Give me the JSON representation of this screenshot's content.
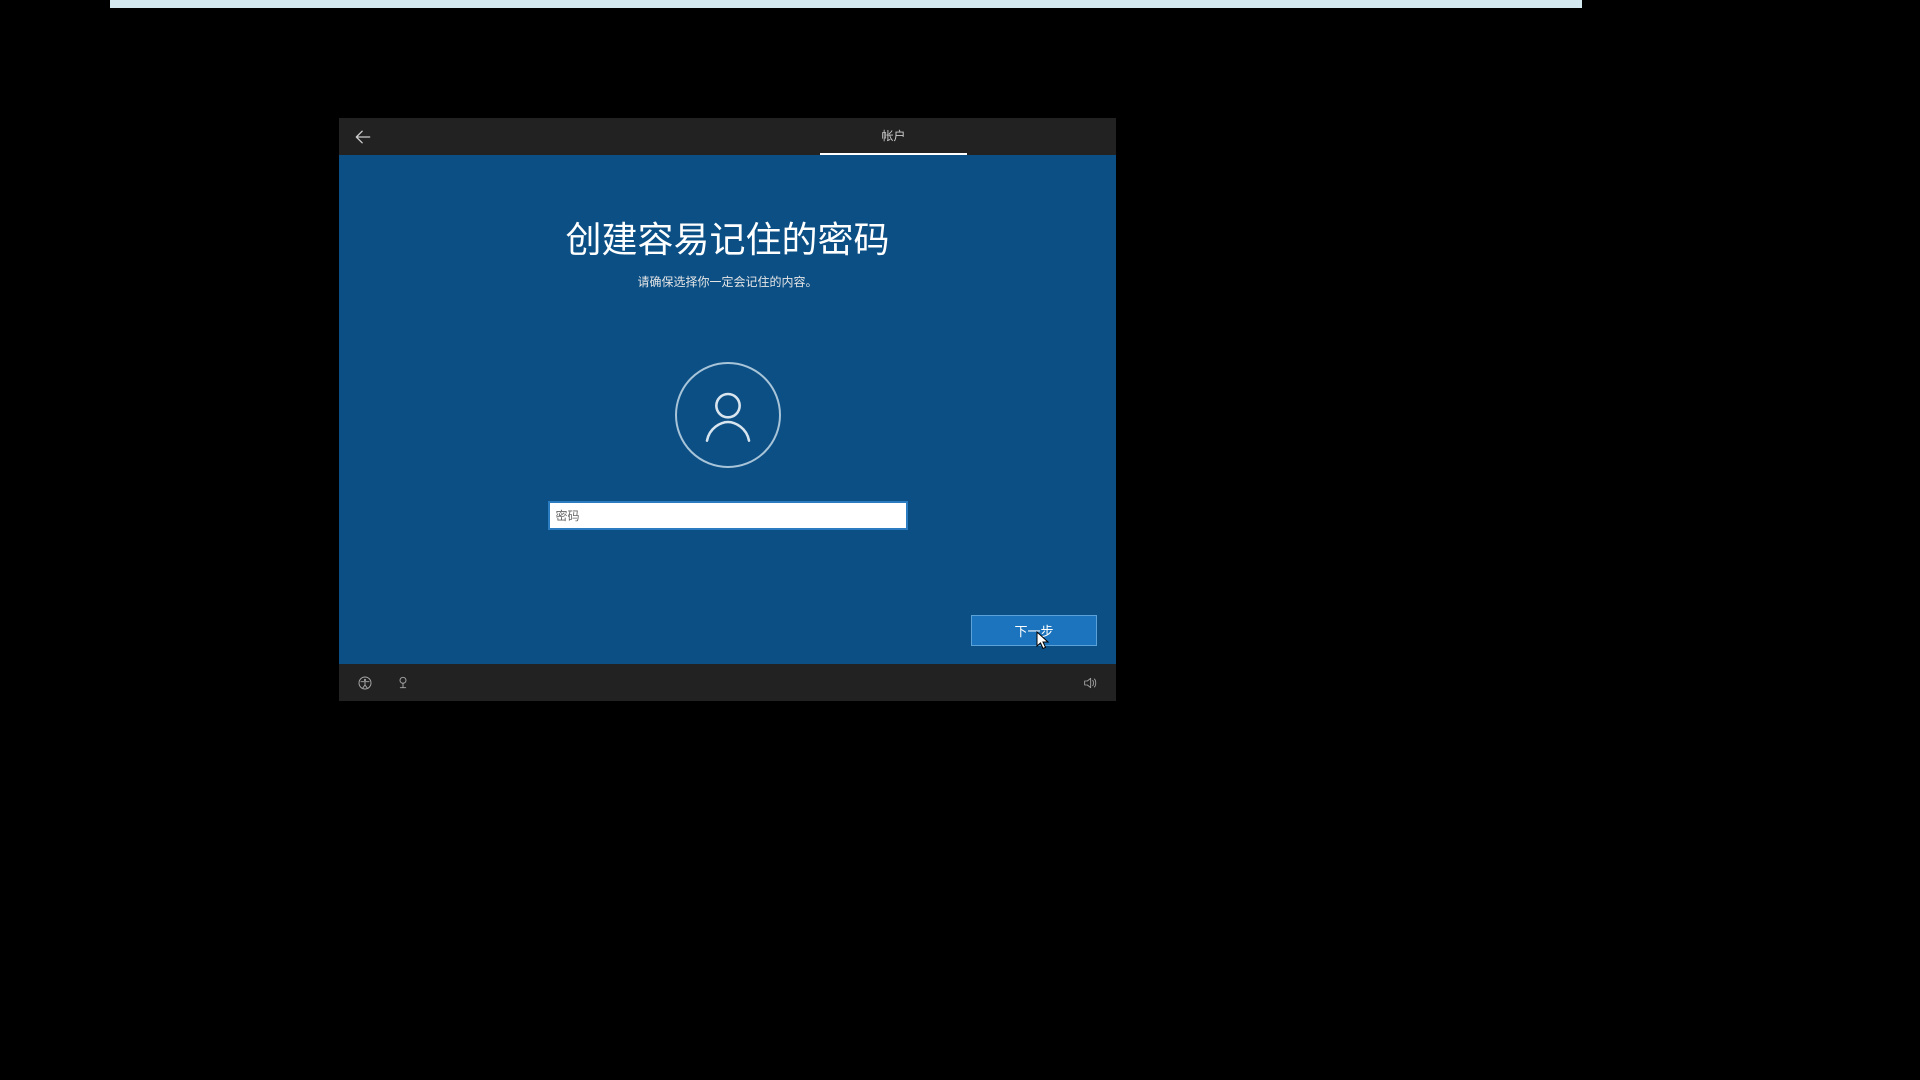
{
  "titlebar": {
    "step_label": "帐户"
  },
  "page": {
    "heading": "创建容易记住的密码",
    "subheading": "请确保选择你一定会记住的内容。"
  },
  "form": {
    "password_placeholder": "密码",
    "password_value": ""
  },
  "actions": {
    "next_label": "下一步"
  },
  "icons": {
    "back": "back-arrow-icon",
    "user": "user-icon",
    "ease_of_access": "ease-of-access-icon",
    "ime": "ime-icon",
    "volume": "volume-icon"
  },
  "colors": {
    "oobe_bg": "#0b4f85",
    "chrome_bg": "#222222",
    "accent_button": "#1b74bd",
    "input_border": "#2a7bbf"
  }
}
